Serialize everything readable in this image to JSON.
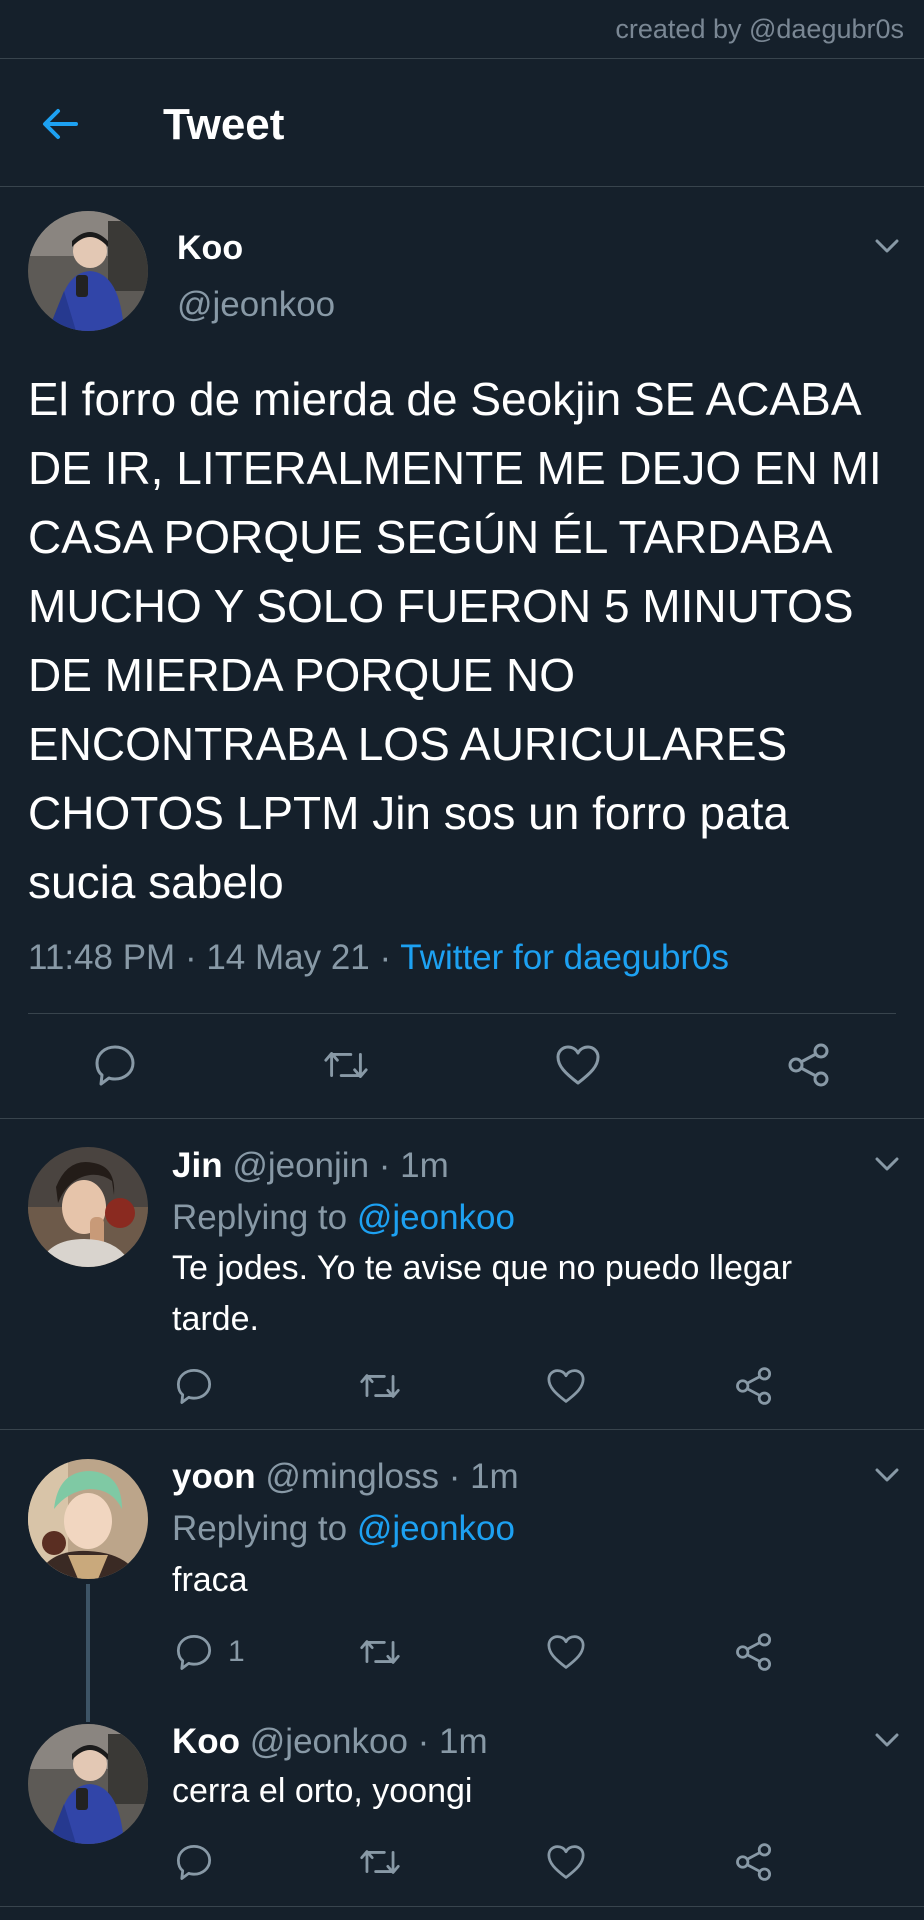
{
  "watermark": "created by @daegubr0s",
  "header": {
    "title": "Tweet",
    "back_icon": "arrow-left-icon"
  },
  "colors": {
    "background": "#15202b",
    "accent": "#1da1f2",
    "muted": "#8899a6",
    "divider": "#38444d"
  },
  "main_tweet": {
    "name": "Koo",
    "handle": "@jeonkoo",
    "text": "El forro de mierda de Seokjin SE ACABA DE IR, LITERALMENTE ME DEJO EN MI CASA PORQUE SEGÚN ÉL TARDABA MUCHO Y SOLO FUERON 5 MINUTOS DE MIERDA PORQUE NO ENCONTRABA LOS AURICULARES CHOTOS LPTM Jin sos un forro pata sucia sabelo",
    "time": "11:48 PM",
    "date": "14 May 21",
    "source": "Twitter for daegubr0s",
    "sep": " · "
  },
  "replies": [
    {
      "name": "Jin",
      "handle": "@jeonjin",
      "time": "1m",
      "replying_label": "Replying to",
      "replying_to": "@jeonkoo",
      "text": "Te jodes. Yo te avise que no puedo llegar tarde.",
      "reply_count": ""
    },
    {
      "name": "yoon",
      "handle": "@mingloss",
      "time": "1m",
      "replying_label": "Replying to",
      "replying_to": "@jeonkoo",
      "text": "fraca",
      "reply_count": "1"
    },
    {
      "name": "Koo",
      "handle": "@jeonkoo",
      "time": "1m",
      "text": "cerra el orto, yoongi",
      "reply_count": ""
    }
  ]
}
